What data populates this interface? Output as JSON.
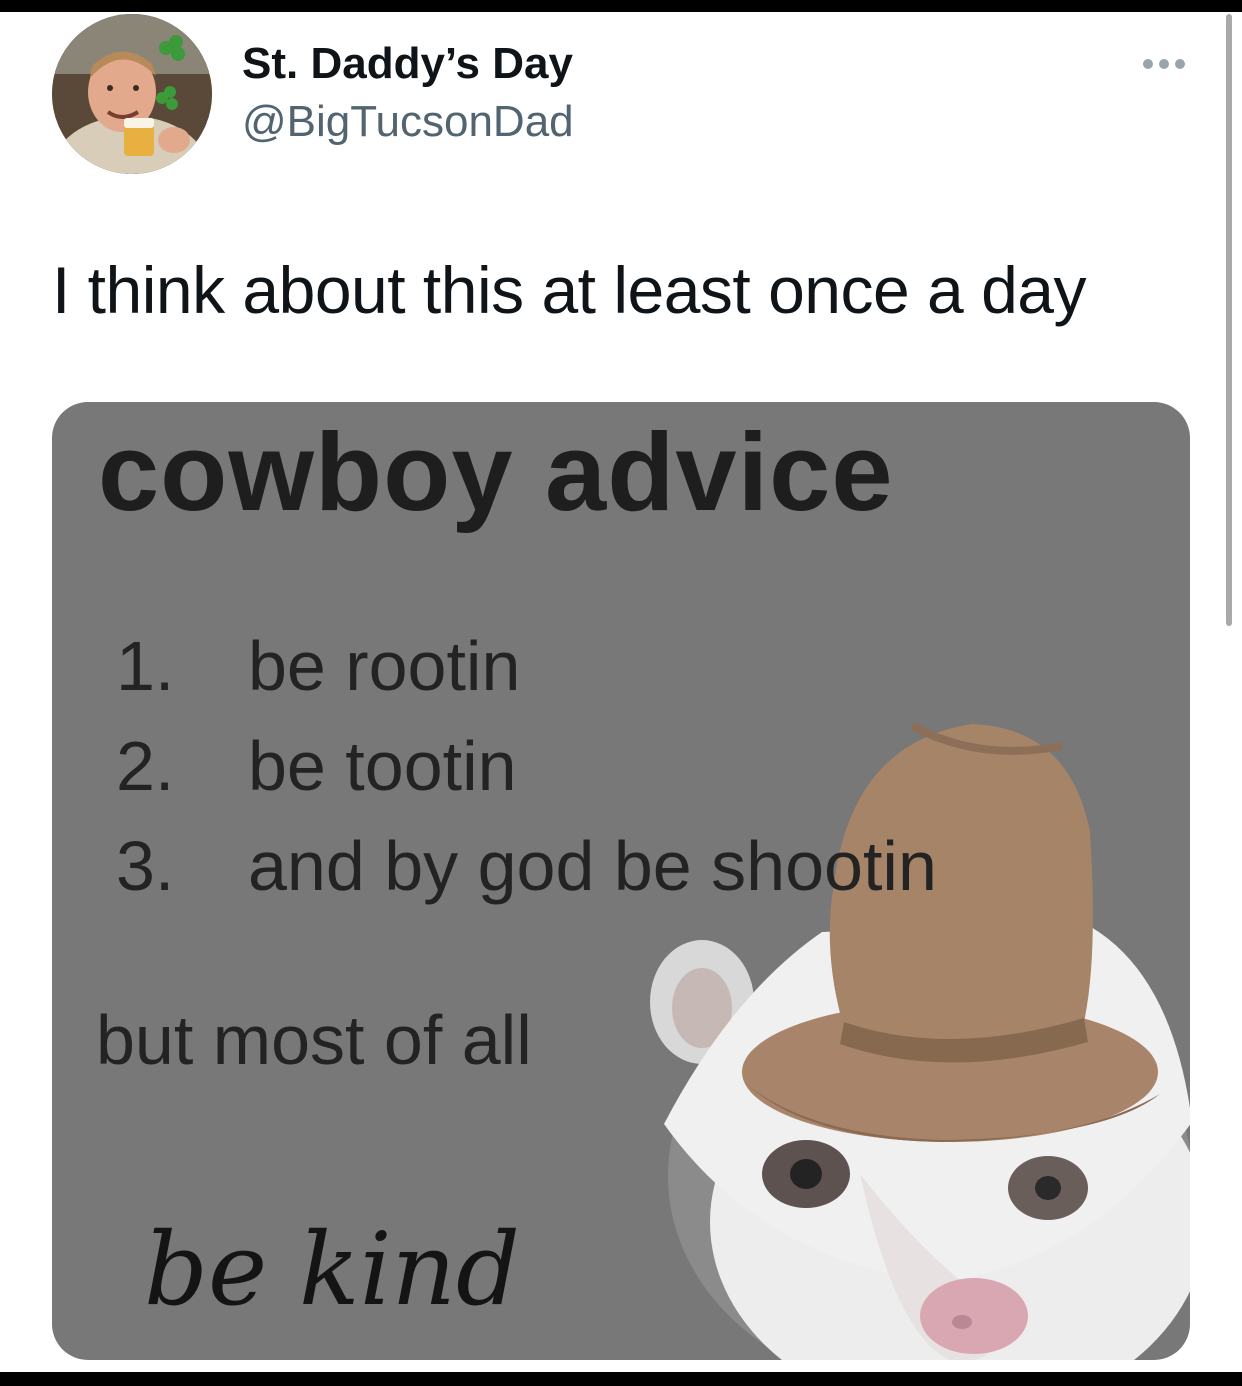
{
  "tweet": {
    "display_name": "St. Daddy’s Day",
    "handle": "@BigTucsonDad",
    "more_icon": "more-dots-icon",
    "text": "I think about this at least once a day"
  },
  "meme": {
    "title": "cowboy advice",
    "items": [
      {
        "num": "1.",
        "text": "be rootin"
      },
      {
        "num": "2.",
        "text": "be tootin"
      },
      {
        "num": "3.",
        "text": "and by god be shootin"
      }
    ],
    "sub": "but most of all",
    "closing": "be kind"
  },
  "colors": {
    "background": "#ffffff",
    "meme_background": "#787879",
    "handle_gray": "#536471",
    "scrollbar": "#a9a9a9"
  }
}
